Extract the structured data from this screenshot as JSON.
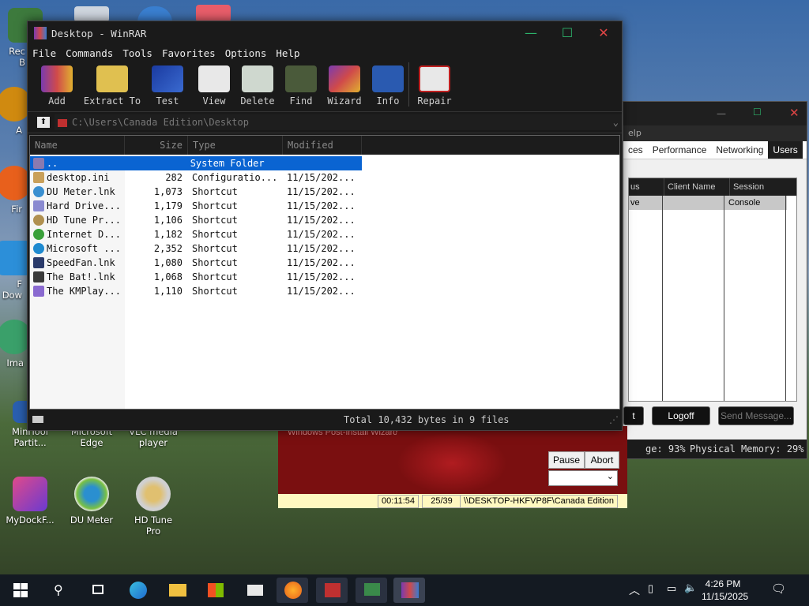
{
  "desktop": {
    "icons": [
      {
        "label": "Rec\nB"
      },
      {
        "label": "A"
      },
      {
        "label": "Fir"
      },
      {
        "label": "F\nDow"
      },
      {
        "label": "Ima"
      },
      {
        "label": "MiniTool\nPartit..."
      },
      {
        "label": "Microsoft\nEdge"
      },
      {
        "label": "VLC media\nplayer"
      },
      {
        "label": "MyDockF..."
      },
      {
        "label": "DU Meter"
      },
      {
        "label": "HD Tune\nPro"
      }
    ]
  },
  "taskmgr": {
    "menu": "elp",
    "tabs": [
      "ces",
      "Performance",
      "Networking",
      "Users"
    ],
    "active_tab": "Users",
    "columns": [
      "us",
      "Client Name",
      "Session"
    ],
    "row": {
      "status": "ve",
      "client": "",
      "session": "Console"
    },
    "buttons": {
      "left": "t",
      "logoff": "Logoff",
      "send": "Send Message..."
    },
    "status": {
      "cpu": "ge: 93%",
      "memory": "Physical Memory: 29%"
    }
  },
  "wizard": {
    "title": "Windows Post-Install Wizard",
    "pause": "Pause",
    "abort": "Abort",
    "select": "",
    "time": "00:11:54",
    "progress": "25/39",
    "path": "\\\\DESKTOP-HKFVP8F\\Canada Edition"
  },
  "winrar": {
    "title": "Desktop - WinRAR",
    "menu": [
      "File",
      "Commands",
      "Tools",
      "Favorites",
      "Options",
      "Help"
    ],
    "toolbar": [
      "Add",
      "Extract To",
      "Test",
      "View",
      "Delete",
      "Find",
      "Wizard",
      "Info",
      "Repair"
    ],
    "path": "C:\\Users\\Canada Edition\\Desktop",
    "columns": {
      "name": "Name",
      "size": "Size",
      "type": "Type",
      "modified": "Modified"
    },
    "rows": [
      {
        "name": "..",
        "size": "",
        "type": "System Folder",
        "modified": ""
      },
      {
        "name": "desktop.ini",
        "size": "282",
        "type": "Configuratio...",
        "modified": "11/15/202..."
      },
      {
        "name": "DU Meter.lnk",
        "size": "1,073",
        "type": "Shortcut",
        "modified": "11/15/202..."
      },
      {
        "name": "Hard Drive...",
        "size": "1,179",
        "type": "Shortcut",
        "modified": "11/15/202..."
      },
      {
        "name": "HD Tune Pr...",
        "size": "1,106",
        "type": "Shortcut",
        "modified": "11/15/202..."
      },
      {
        "name": "Internet D...",
        "size": "1,182",
        "type": "Shortcut",
        "modified": "11/15/202..."
      },
      {
        "name": "Microsoft ...",
        "size": "2,352",
        "type": "Shortcut",
        "modified": "11/15/202..."
      },
      {
        "name": "SpeedFan.lnk",
        "size": "1,080",
        "type": "Shortcut",
        "modified": "11/15/202..."
      },
      {
        "name": "The Bat!.lnk",
        "size": "1,068",
        "type": "Shortcut",
        "modified": "11/15/202..."
      },
      {
        "name": "The KMPlay...",
        "size": "1,110",
        "type": "Shortcut",
        "modified": "11/15/202..."
      }
    ],
    "status": "Total 10,432 bytes in 9 files"
  },
  "taskbar": {
    "time": "4:26 PM",
    "date": "11/15/2025"
  },
  "colors": {
    "selection": "#0a64d2",
    "winrar_bg": "#1a1a1a",
    "taskbar": "#141a22"
  }
}
